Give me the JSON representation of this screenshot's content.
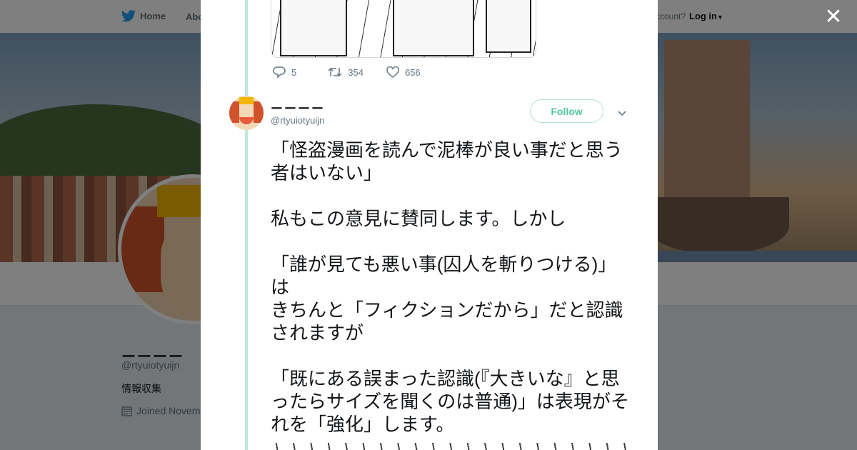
{
  "topbar": {
    "home_label": "Home",
    "about_label": "Abo",
    "account_prompt": "ccount?",
    "login_label": "Log in"
  },
  "profile": {
    "name": "ーーーー",
    "handle": "@rtyuiotyuijn",
    "bio": "情報収集",
    "joined": "Joined Novem"
  },
  "prev_tweet": {
    "reply_count": "5",
    "retweet_count": "354",
    "like_count": "656"
  },
  "tweet": {
    "author_name": "ーーーー",
    "author_handle": "@rtyuiotyuijn",
    "follow_label": "Follow",
    "text": "「怪盗漫画を読んで泥棒が良い事だと思う者はいない」\n\n私もこの意見に賛同します。しかし\n\n「誰が見ても悪い事(囚人を斬りつける)」は\nきちんと「フィクションだから」だと認識されますが\n\n「既にある誤まった認識(『大きいな』と思ったらサイズを聞くのは普通)」は表現がそれを「強化」します。"
  },
  "colors": {
    "accent": "#4ec7a0",
    "thread_line": "#bcead8",
    "overlay": "rgba(0,0,0,0.5)",
    "text": "#14171a",
    "muted": "#657786"
  },
  "icons": [
    "twitter-bird-icon",
    "caret-down-icon",
    "close-icon",
    "reply-icon",
    "retweet-icon",
    "like-icon",
    "chevron-down-icon",
    "calendar-icon"
  ]
}
